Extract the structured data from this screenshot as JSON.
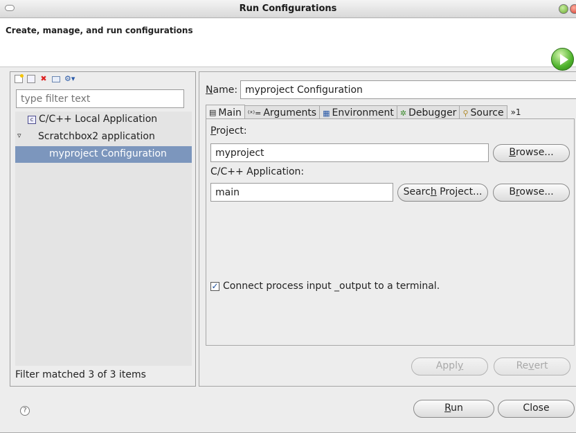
{
  "window": {
    "title": "Run Configurations"
  },
  "banner": {
    "subtitle": "Create, manage, and run configurations"
  },
  "left": {
    "filter_placeholder": "type filter text",
    "tree": [
      {
        "label": "C/C++ Local Application",
        "icon": "c-app-icon"
      },
      {
        "label": "Scratchbox2 application",
        "expanded": true
      },
      {
        "label": "myproject Configuration",
        "selected": true
      }
    ],
    "status": "Filter matched 3 of 3 items"
  },
  "right": {
    "name_label": "Name:",
    "name_value": "myproject Configuration",
    "tabs": [
      {
        "label": "Main",
        "icon": "main-tab-icon",
        "active": true
      },
      {
        "label": "Arguments",
        "icon": "arguments-icon"
      },
      {
        "label": "Environment",
        "icon": "environment-icon"
      },
      {
        "label": "Debugger",
        "icon": "debugger-icon"
      },
      {
        "label": "Source",
        "icon": "source-icon"
      }
    ],
    "tabs_overflow": "»1",
    "main": {
      "project_label": "Project:",
      "project_value": "myproject",
      "browse_label": "Browse...",
      "app_label": "C/C++ Application:",
      "app_value": "main",
      "search_project_label": "Search Project...",
      "browse2_label": "Browse...",
      "terminal_checkbox": {
        "checked": true,
        "label": "Connect process input _output to a terminal."
      }
    },
    "apply_label": "Apply",
    "revert_label": "Revert"
  },
  "footer": {
    "run_label": "Run",
    "close_label": "Close"
  }
}
